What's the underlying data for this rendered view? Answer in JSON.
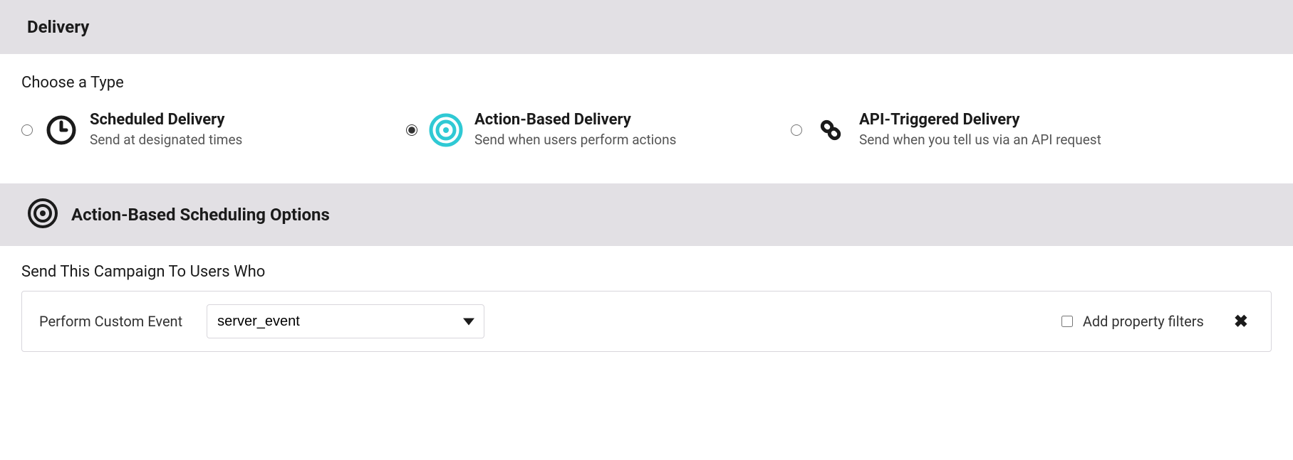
{
  "header": {
    "title": "Delivery"
  },
  "choose_type": {
    "label": "Choose a Type",
    "options": [
      {
        "title": "Scheduled Delivery",
        "desc": "Send at designated times",
        "selected": false
      },
      {
        "title": "Action-Based Delivery",
        "desc": "Send when users perform actions",
        "selected": true
      },
      {
        "title": "API-Triggered Delivery",
        "desc": "Send when you tell us via an API request",
        "selected": false
      }
    ]
  },
  "options_section": {
    "title": "Action-Based Scheduling Options"
  },
  "trigger": {
    "section_label": "Send This Campaign To Users Who",
    "row_label": "Perform Custom Event",
    "selected_event": "server_event",
    "add_filters_label": "Add property filters",
    "add_filters_checked": false
  },
  "colors": {
    "accent": "#2fc9d4"
  }
}
